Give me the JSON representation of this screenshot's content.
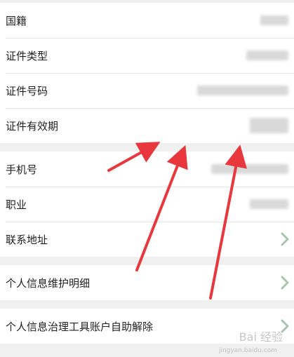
{
  "identity_section": {
    "nationality_label": "国籍",
    "id_type_label": "证件类型",
    "id_number_label": "证件号码",
    "id_validity_label": "证件有效期"
  },
  "contact_section": {
    "phone_label": "手机号",
    "occupation_label": "职业",
    "address_label": "联系地址"
  },
  "maintenance_section": {
    "history_label": "个人信息维护明细"
  },
  "governance_section": {
    "unbind_label": "个人信息治理工具账户自助解除"
  },
  "annotation": {
    "arrow_color": "#e8383d"
  },
  "watermark": {
    "text": "Bai 经验",
    "sub": "jingyan.baidu.com"
  },
  "colors": {
    "chevron": "#a9c4ad",
    "divider": "#e6e6e6"
  }
}
